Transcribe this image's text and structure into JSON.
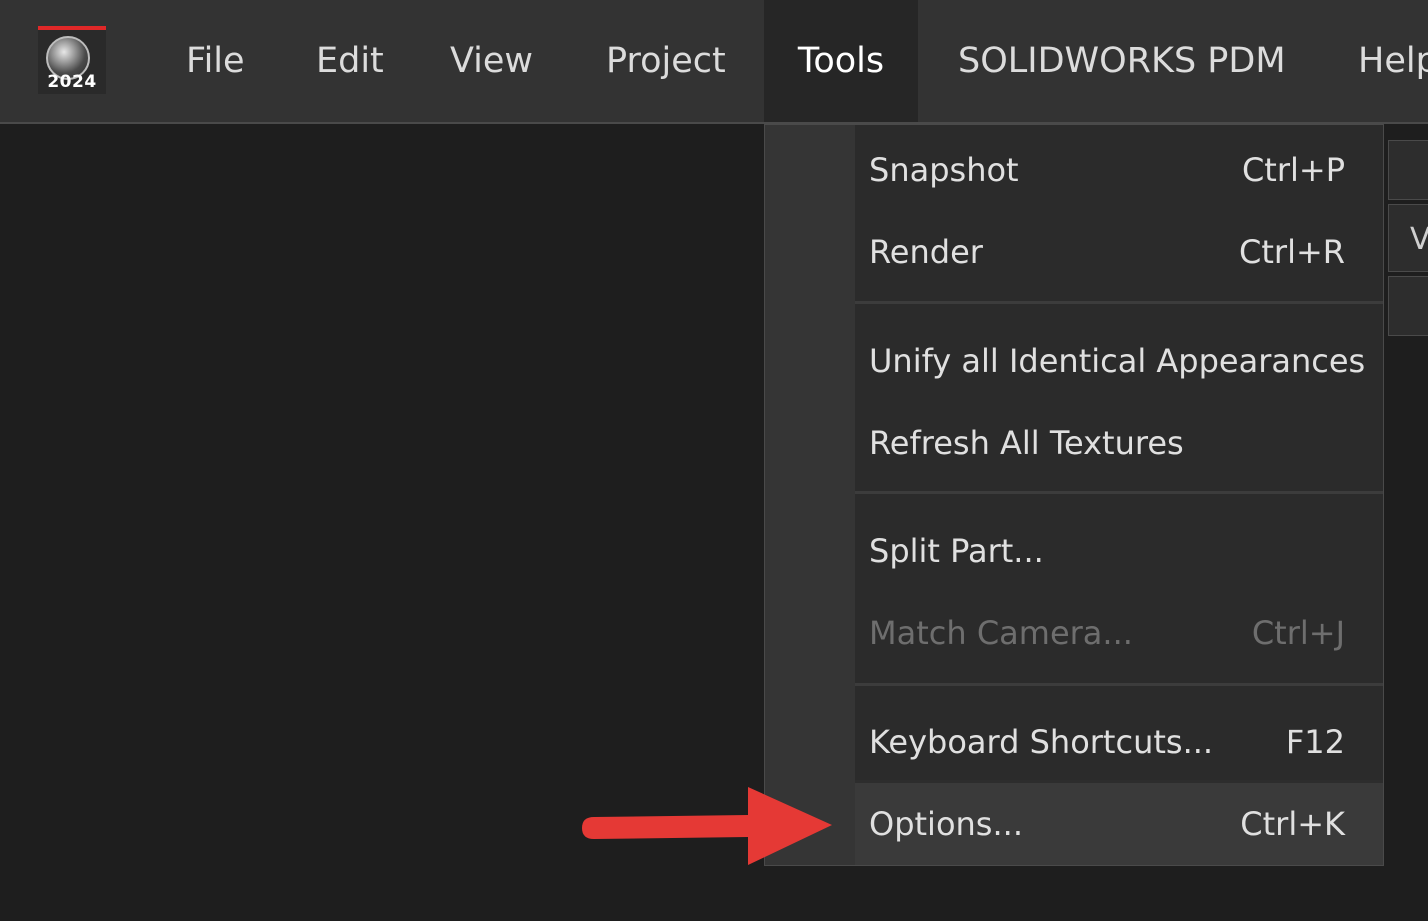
{
  "app": {
    "logo_year": "2024",
    "logo_name": "solidworks-visualize-logo"
  },
  "menubar": {
    "items": [
      {
        "label": "File"
      },
      {
        "label": "Edit"
      },
      {
        "label": "View"
      },
      {
        "label": "Project"
      },
      {
        "label": "Tools",
        "active": true
      },
      {
        "label": "SOLIDWORKS PDM"
      },
      {
        "label": "Help"
      }
    ]
  },
  "tools_menu": {
    "items": [
      {
        "label": "Snapshot",
        "shortcut": "Ctrl+P",
        "enabled": true
      },
      {
        "label": "Render",
        "shortcut": "Ctrl+R",
        "enabled": true
      },
      {
        "label": "Unify all Identical Appearances",
        "shortcut": "",
        "enabled": true
      },
      {
        "label": "Refresh All Textures",
        "shortcut": "",
        "enabled": true
      },
      {
        "label": "Split Part...",
        "shortcut": "",
        "enabled": true
      },
      {
        "label": "Match Camera...",
        "shortcut": "Ctrl+J",
        "enabled": false
      },
      {
        "label": "Keyboard Shortcuts...",
        "shortcut": "F12",
        "enabled": true
      },
      {
        "label": "Options...",
        "shortcut": "Ctrl+K",
        "enabled": true,
        "highlighted": true
      }
    ]
  },
  "right_peek_letter": "V",
  "colors": {
    "background": "#1e1e1e",
    "menubar": "#333333",
    "accent_red": "#e53935"
  }
}
